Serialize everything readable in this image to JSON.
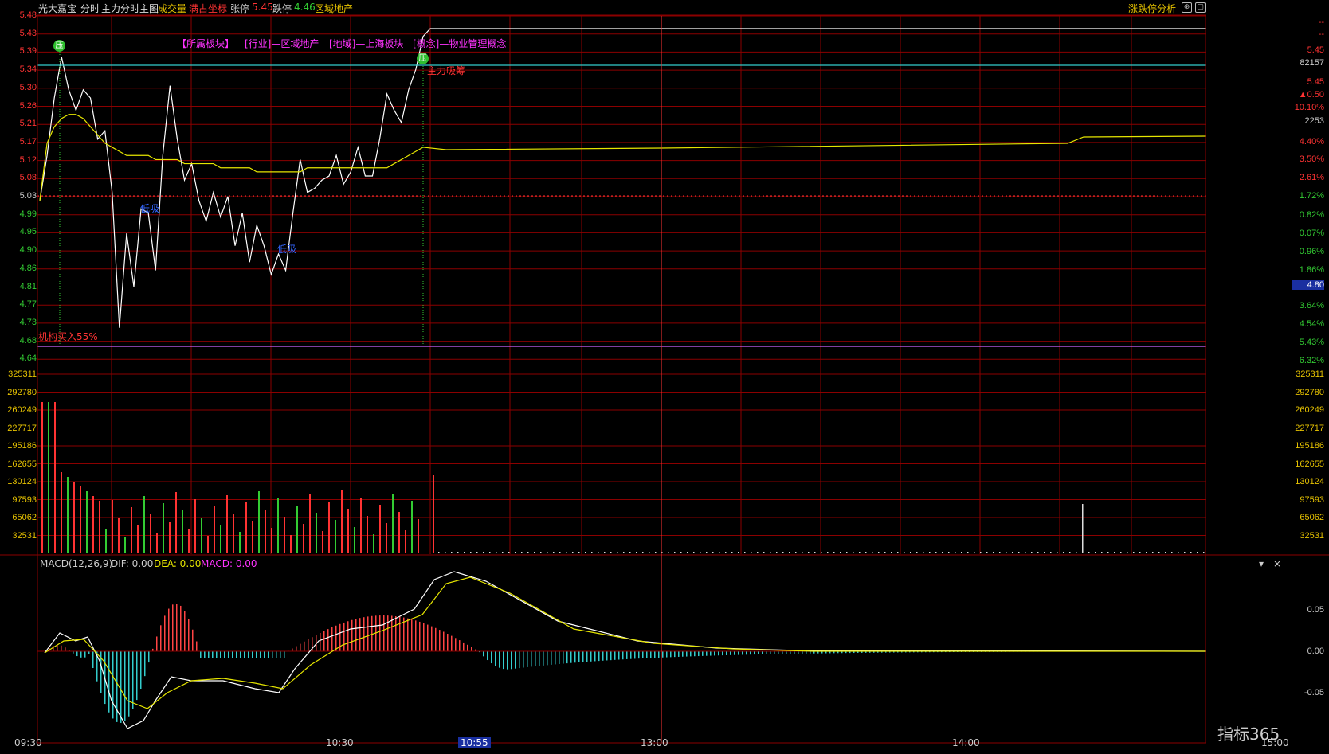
{
  "header": {
    "stock_name": "光大嘉宝",
    "mode": "分时",
    "main_chart": "主力分时主图",
    "volume": "成交量",
    "full_axis": "满占坐标",
    "limit_up_label": "张停",
    "limit_up_value": "5.45",
    "limit_down_label": "跌停",
    "limit_down_value": "4.46",
    "sector": "区域地产",
    "analysis": "涨跌停分析"
  },
  "tags": {
    "sector_block": "【所属板块】",
    "industry": "[行业]—区域地产",
    "region": "[地域]—上海板块",
    "concept": "[概念]—物业管理概念",
    "main_force": "主力吸筹",
    "inst_buy": "机构买入55%",
    "low_tag_1": "低吸",
    "low_tag_2": "低吸",
    "badge": "压"
  },
  "price_axis_left": [
    "5.48",
    "5.43",
    "5.39",
    "5.34",
    "5.30",
    "5.26",
    "5.21",
    "5.17",
    "5.12",
    "5.08",
    "5.03",
    "4.99",
    "4.95",
    "4.90",
    "4.86",
    "4.81",
    "4.77",
    "4.73",
    "4.68",
    "4.64"
  ],
  "price_axis_right": [
    "--",
    "--",
    "5.45",
    "82157",
    "5.45",
    "▲0.50",
    "10.10%",
    "2253",
    "4.40%",
    "3.50%",
    "2.61%",
    "1.72%",
    "0.82%",
    "0.07%",
    "0.96%",
    "1.86%",
    "4.80",
    "3.64%",
    "4.54%",
    "5.43%",
    "6.32%"
  ],
  "volume_axis": [
    "325311",
    "292780",
    "260249",
    "227717",
    "195186",
    "162655",
    "130124",
    "97593",
    "65062",
    "32531"
  ],
  "macd": {
    "title": "MACD(12,26,9)",
    "dif": "DIF: 0.00",
    "dea": "DEA: 0.00",
    "macd": "MACD: 0.00",
    "axis": [
      "0.05",
      "0.00",
      "-0.05"
    ]
  },
  "time_axis": [
    "09:30",
    "10:30",
    "10:55",
    "13:00",
    "14:00",
    "15:00"
  ],
  "watermark": "指标365",
  "colors": {
    "grid": "#8b0000",
    "price": "#ffffff",
    "avg": "#e6e600",
    "up": "#ff3333",
    "down": "#33cc33",
    "accent": "#ff33ff"
  },
  "chart_data": {
    "type": "line",
    "price_series": [
      5.03,
      5.14,
      5.28,
      5.38,
      5.3,
      5.25,
      5.3,
      5.28,
      5.18,
      5.2,
      5.05,
      4.72,
      4.95,
      4.82,
      5.01,
      5.0,
      4.86,
      5.14,
      5.31,
      5.18,
      5.08,
      5.12,
      5.03,
      4.98,
      5.05,
      4.99,
      5.04,
      4.92,
      5.0,
      4.88,
      4.97,
      4.92,
      4.85,
      4.9,
      4.86,
      5.0,
      5.13,
      5.05,
      5.06,
      5.08,
      5.09,
      5.14,
      5.07,
      5.1,
      5.16,
      5.09,
      5.09,
      5.18,
      5.29,
      5.25,
      5.22,
      5.3,
      5.35,
      5.43
    ],
    "avg_series": [
      5.03,
      5.17,
      5.21,
      5.23,
      5.24,
      5.24,
      5.23,
      5.21,
      5.19,
      5.17,
      5.16,
      5.15,
      5.14,
      5.14,
      5.14,
      5.14,
      5.13,
      5.13,
      5.13,
      5.13,
      5.12,
      5.12,
      5.12,
      5.12,
      5.12,
      5.11,
      5.11,
      5.11,
      5.11,
      5.11,
      5.1,
      5.1,
      5.1,
      5.1,
      5.1,
      5.1,
      5.1,
      5.11,
      5.11,
      5.11,
      5.11,
      5.11,
      5.11,
      5.11,
      5.11,
      5.11,
      5.11,
      5.11,
      5.11,
      5.12,
      5.13,
      5.14,
      5.15,
      5.16
    ],
    "ylim": [
      4.64,
      5.48
    ]
  }
}
